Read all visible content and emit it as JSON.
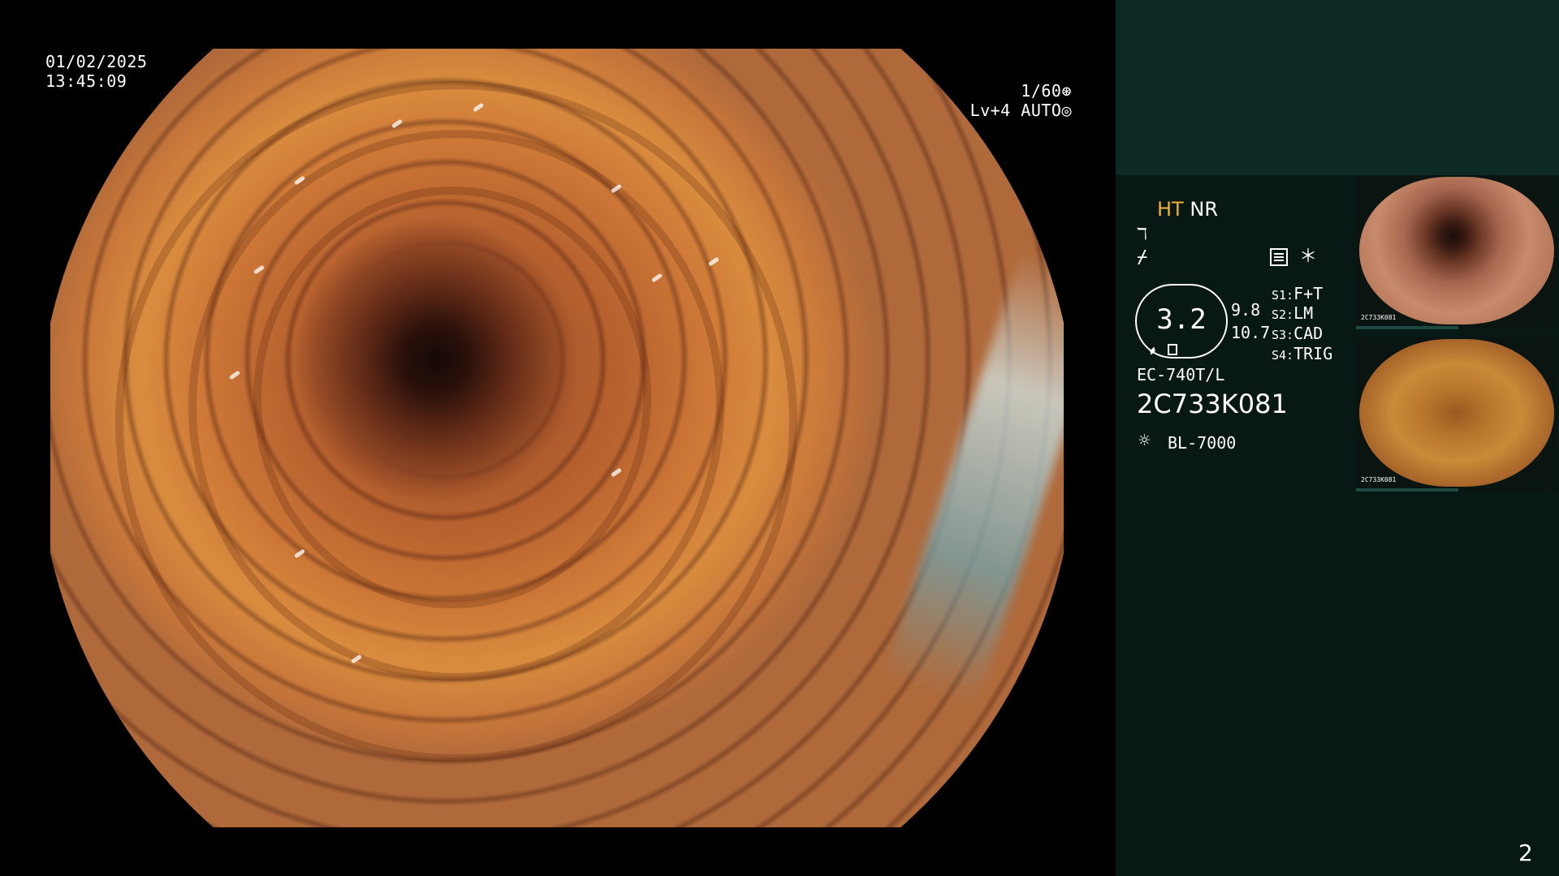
{
  "overlay": {
    "date": "01/02/2025",
    "time": "13:45:09",
    "shutter": "1/60",
    "shutter_icon": "aperture-icon",
    "level": "Lv+4",
    "mode": "AUTO",
    "mode_icon": "iris-icon"
  },
  "panel": {
    "ht": "HT",
    "nr": "NR",
    "sym1": "ℸ",
    "sym2": "⌿",
    "menu_icon": "menu-icon",
    "asterisk": "＊",
    "hex_value": "3.2",
    "v1": "9.8",
    "v2": "10.7",
    "scopes": [
      {
        "key": "S1:",
        "label": "F+T"
      },
      {
        "key": "S2:",
        "label": "LM"
      },
      {
        "key": "S3:",
        "label": "CAD"
      },
      {
        "key": "S4:",
        "label": "TRIG"
      }
    ],
    "model": "EC-740T/L",
    "serial": "2C733K081",
    "light_icon": "light-source-icon",
    "light": "BL-7000"
  },
  "thumbnails": [
    {
      "caption": "2C733K081"
    },
    {
      "caption": "2C733K081"
    }
  ],
  "page_number": "2",
  "colors": {
    "ht": "#f0b030",
    "panel_bg": "#081815",
    "panel_top": "#0d2a27"
  }
}
